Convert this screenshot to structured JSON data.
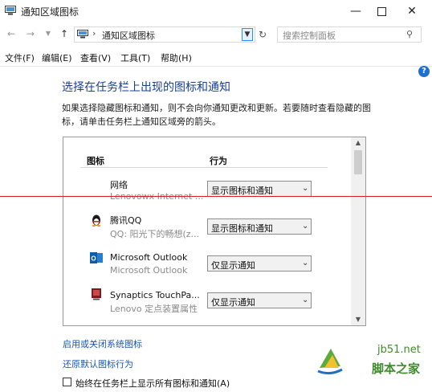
{
  "window": {
    "title": "通知区域图标"
  },
  "address": {
    "path": "通知区域图标",
    "search_placeholder": "搜索控制面板"
  },
  "menu": [
    "文件(F)",
    "编辑(E)",
    "查看(V)",
    "工具(T)",
    "帮助(H)"
  ],
  "content": {
    "heading": "选择在任务栏上出现的图标和通知",
    "description": "如果选择隐藏图标和通知，则不会向你通知更改和更新。若要随时查看隐藏的图标，请单击任务栏上通知区域旁的箭头。",
    "columns": {
      "icon": "图标",
      "behavior": "行为"
    },
    "rows": [
      {
        "name": "网络",
        "sub": "Lenovowx Internet ...",
        "behavior": "显示图标和通知",
        "icon": "network-icon"
      },
      {
        "name": "腾讯QQ",
        "sub": "QQ: 阳光下的畅想(z...",
        "behavior": "显示图标和通知",
        "icon": "qq-penguin-icon"
      },
      {
        "name": "Microsoft Outlook",
        "sub": "Microsoft Outlook",
        "behavior": "仅显示通知",
        "icon": "outlook-icon"
      },
      {
        "name": "Synaptics TouchPa...",
        "sub": "Lenovo 定点装置属性",
        "behavior": "仅显示通知",
        "icon": "touchpad-icon"
      }
    ]
  },
  "links": {
    "system_icons": "启用或关闭系统图标",
    "restore_defaults": "还原默认图标行为"
  },
  "checkbox": {
    "label": "始终在任务栏上显示所有图标和通知(A)",
    "checked": false
  },
  "watermark": {
    "url": "jb51.net",
    "name": "脚本之家"
  },
  "colors": {
    "heading": "#1a3f93",
    "link": "#1a56b3",
    "watermark": "#3d8b2a",
    "guide_line": "#d62020"
  }
}
